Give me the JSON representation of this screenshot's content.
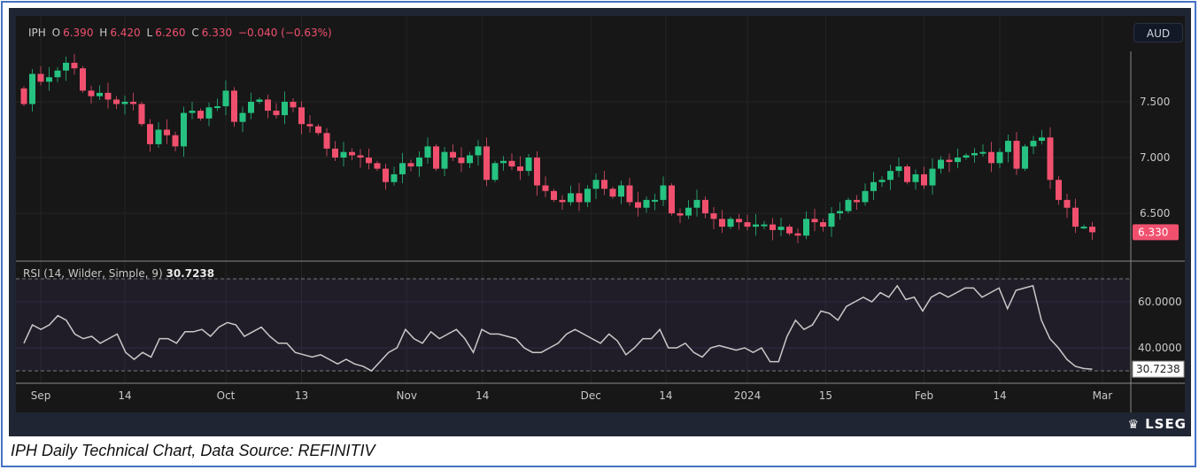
{
  "header": {
    "symbol": "IPH",
    "o_label": "O",
    "o": "6.390",
    "h_label": "H",
    "h": "6.420",
    "l_label": "L",
    "l": "6.260",
    "c_label": "C",
    "c": "6.330",
    "change": "−0.040 (−0.63%)",
    "currency": "AUD"
  },
  "rsi": {
    "label": "RSI (14, Wilder, Simple, 9)",
    "value": "30.7238"
  },
  "brand": "LSEG",
  "caption": "IPH Daily Technical Chart, Data Source: REFINITIV",
  "colors": {
    "up": "#26c281",
    "down": "#f0506e",
    "rsi_line": "#c9c9c9"
  },
  "chart_data": [
    {
      "type": "candlestick",
      "title": "IPH",
      "ylim": [
        6.15,
        8.0
      ],
      "yticks": [
        "7.500",
        "7.000",
        "6.500"
      ],
      "ytick_values": [
        7.5,
        7.0,
        6.5
      ],
      "last_price": "6.330",
      "closes": [
        7.48,
        7.75,
        7.68,
        7.72,
        7.78,
        7.85,
        7.8,
        7.6,
        7.55,
        7.58,
        7.52,
        7.48,
        7.5,
        7.48,
        7.3,
        7.12,
        7.25,
        7.2,
        7.1,
        7.4,
        7.42,
        7.35,
        7.45,
        7.46,
        7.6,
        7.32,
        7.4,
        7.5,
        7.52,
        7.42,
        7.38,
        7.5,
        7.45,
        7.3,
        7.28,
        7.22,
        7.08,
        7.0,
        7.05,
        7.02,
        7.0,
        6.95,
        6.9,
        6.78,
        6.85,
        6.95,
        6.92,
        7.0,
        7.1,
        6.9,
        7.05,
        7.0,
        6.95,
        7.02,
        7.1,
        6.8,
        6.95,
        6.97,
        6.92,
        6.88,
        7.0,
        6.75,
        6.7,
        6.62,
        6.6,
        6.68,
        6.6,
        6.72,
        6.8,
        6.72,
        6.65,
        6.75,
        6.6,
        6.55,
        6.62,
        6.62,
        6.75,
        6.5,
        6.48,
        6.55,
        6.62,
        6.5,
        6.45,
        6.38,
        6.45,
        6.42,
        6.38,
        6.4,
        6.4,
        6.35,
        6.38,
        6.32,
        6.3,
        6.45,
        6.42,
        6.38,
        6.5,
        6.52,
        6.62,
        6.6,
        6.7,
        6.78,
        6.8,
        6.88,
        6.92,
        6.78,
        6.85,
        6.75,
        6.9,
        6.98,
        6.96,
        7.0,
        7.02,
        7.04,
        7.05,
        6.95,
        7.05,
        7.15,
        6.9,
        7.1,
        7.15,
        7.18,
        6.8,
        6.62,
        6.55,
        6.38,
        6.38,
        6.33
      ],
      "first_open": 7.62,
      "xticks": [
        {
          "label": "Sep",
          "index": 2
        },
        {
          "label": "14",
          "index": 12
        },
        {
          "label": "Oct",
          "index": 24
        },
        {
          "label": "13",
          "index": 33
        },
        {
          "label": "Nov",
          "index": 45.5
        },
        {
          "label": "14",
          "index": 54.5
        },
        {
          "label": "Dec",
          "index": 67.4
        },
        {
          "label": "14",
          "index": 76.3
        },
        {
          "label": "2024",
          "index": 86
        },
        {
          "label": "15",
          "index": 95.3
        },
        {
          "label": "Feb",
          "index": 107
        },
        {
          "label": "14",
          "index": 116
        },
        {
          "label": "Mar",
          "index": 128.2
        }
      ]
    },
    {
      "type": "line",
      "title": "RSI (14, Wilder, Simple, 9)",
      "ylim": [
        22,
        75
      ],
      "band": [
        30,
        70
      ],
      "yticks": [
        "60.0000",
        "40.0000"
      ],
      "ytick_values": [
        60,
        40
      ],
      "values": [
        42,
        50,
        48,
        50,
        54,
        52,
        46,
        44,
        45,
        42,
        44,
        46,
        38,
        35,
        38,
        36,
        44,
        44,
        42,
        47,
        47,
        48,
        45,
        49,
        51,
        50,
        45,
        47,
        49,
        45,
        42,
        42,
        38,
        37,
        36,
        37,
        35,
        33,
        35,
        33,
        32,
        30,
        34,
        38,
        40,
        48,
        44,
        42,
        47,
        44,
        46,
        48,
        44,
        38,
        48,
        46,
        46,
        45,
        44,
        40,
        38,
        38,
        40,
        42,
        46,
        48,
        46,
        44,
        42,
        46,
        43,
        37,
        40,
        44,
        44,
        48,
        40,
        40,
        42,
        38,
        36,
        40,
        41,
        40,
        39,
        40,
        38,
        40,
        34,
        34,
        45,
        52,
        48,
        50,
        56,
        55,
        52,
        58,
        60,
        62,
        60,
        64,
        62,
        67,
        61,
        62,
        56,
        62,
        64,
        62,
        64,
        66,
        66,
        62,
        64,
        66,
        57,
        65,
        66,
        67,
        52,
        44,
        40,
        35,
        32,
        31,
        30.7238
      ]
    }
  ]
}
